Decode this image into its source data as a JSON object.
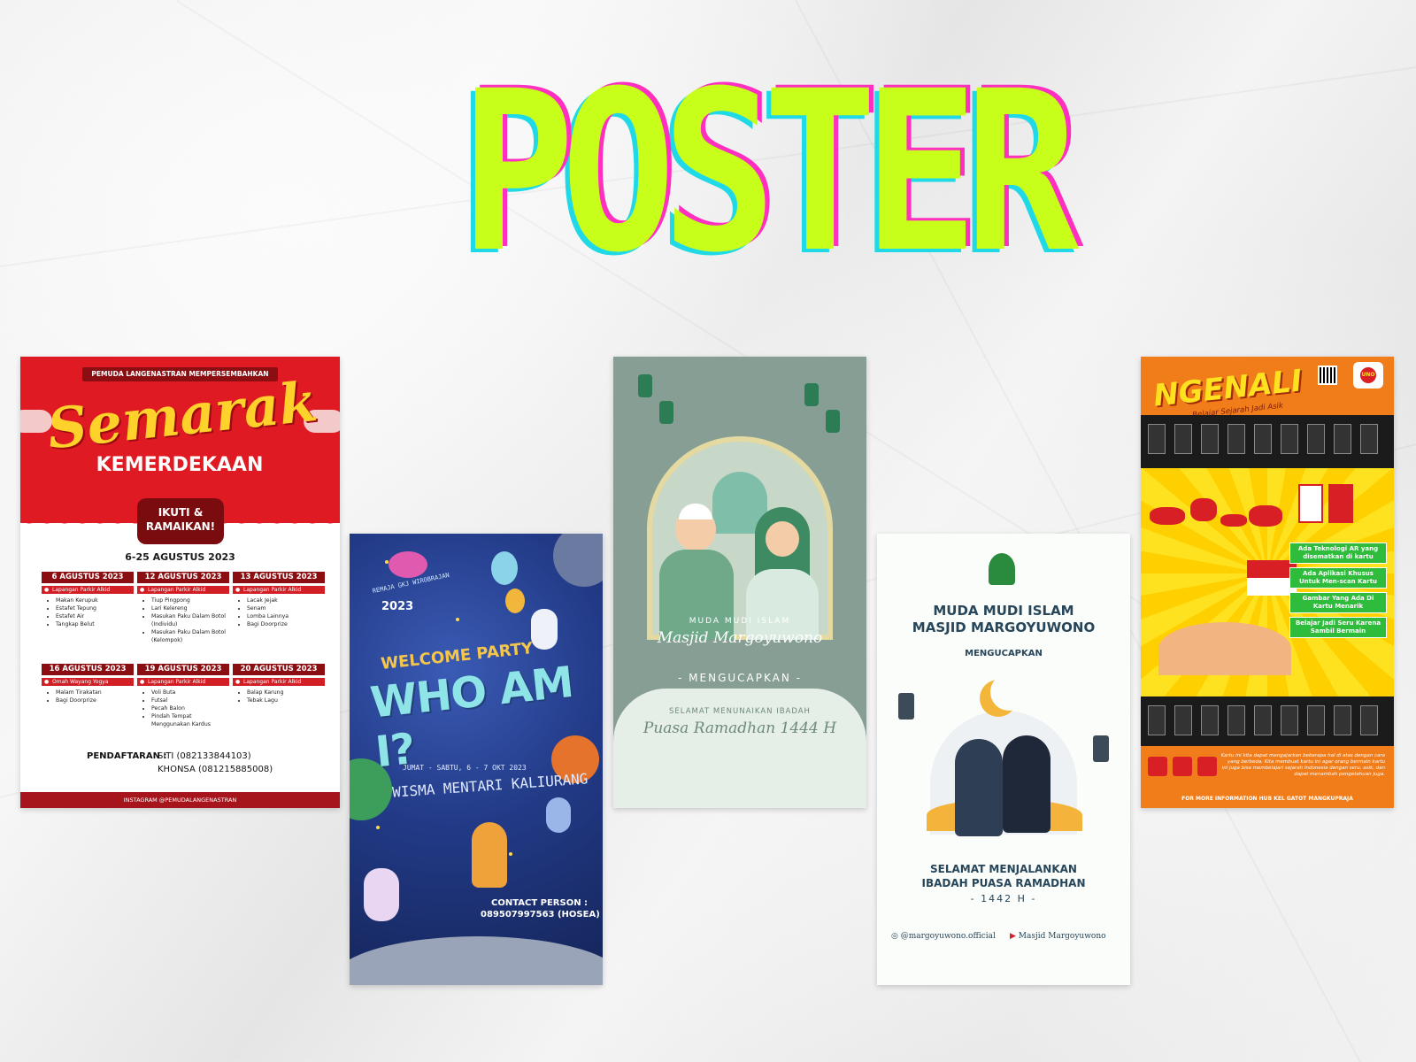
{
  "title": "POSTER",
  "colors": {
    "title_main": "#c8ff1a",
    "title_cyan": "#1fd9e6",
    "title_pink": "#ff2fc0"
  },
  "poster1": {
    "pill": "PEMUDA LANGENASTRAN MEMPERSEMBAHKAN",
    "semarak": "Semarak",
    "kemerdekaan": "KEMERDEKAAN",
    "ikuti": "IKUTI &",
    "ramaikan": "RAMAIKAN!",
    "dates": "6-25 AGUSTUS 2023",
    "events": [
      {
        "date": "6 AGUSTUS 2023",
        "location": "Lapangan Parkir Alkid",
        "items": [
          "Makan Kerupuk",
          "Estafet Tepung",
          "Estafet Air",
          "Tangkap Belut"
        ]
      },
      {
        "date": "12 AGUSTUS 2023",
        "location": "Lapangan Parkir Alkid",
        "items": [
          "Tiup Pingpong",
          "Lari Kelereng",
          "Masukan Paku Dalam Botol (Individu)",
          "Masukan Paku Dalam Botol (Kelompok)"
        ]
      },
      {
        "date": "13 AGUSTUS 2023",
        "location": "Lapangan Parkir Alkid",
        "items": [
          "Lacak Jejak",
          "Senam",
          "Lomba Lainnya",
          "Bagi Doorprize"
        ]
      },
      {
        "date": "16 AGUSTUS 2023",
        "location": "Omah Wayang Yogya",
        "items": [
          "Malam Tirakatan",
          "Bagi Doorprize"
        ]
      },
      {
        "date": "19 AGUSTUS 2023",
        "location": "Lapangan Parkir Alkid",
        "items": [
          "Voli Buta",
          "Futsal",
          "Pecah Balon",
          "Pindah Tempat Menggunakan Kardus"
        ]
      },
      {
        "date": "20 AGUSTUS 2023",
        "location": "Lapangan Parkir Alkid",
        "items": [
          "Balap Karung",
          "Tebak Lagu"
        ]
      }
    ],
    "registration_label": "PENDAFTARAN :",
    "registration_1": "SITI (082133844103)",
    "registration_2": "KHONSA (081215885008)",
    "footer": "INSTAGRAM @PEMUDALANGENASTRAN"
  },
  "poster2": {
    "sub": "REMAJA GKJ WIROBRAJAN",
    "year": "2023",
    "welcome": "WELCOME PARTY",
    "who": "WHO AM I?",
    "date": "JUMAT - SABTU, 6 - 7 OKT 2023",
    "venue": "WISMA MENTARI KALIURANG",
    "contact_label": "CONTACT PERSON :",
    "contact_value": "089507997563 (HOSEA)"
  },
  "poster3": {
    "mudi": "MUDA MUDI ISLAM",
    "masjid": "Masjid Margoyuwono",
    "mengucapkan": "- MENGUCAPKAN -",
    "selamat": "SELAMAT MENUNAIKAN IBADAH",
    "puasa": "Puasa Ramadhan 1444 H"
  },
  "poster4": {
    "line1": "MUDA MUDI ISLAM",
    "line2": "MASJID MARGOYUWONO",
    "mengucapkan": "MENGUCAPKAN",
    "sel1": "SELAMAT MENJALANKAN",
    "sel2": "IBADAH PUASA RAMADHAN",
    "hijri": "- 1442 H -",
    "instagram": "@margoyuwono.official",
    "youtube": "Masjid Margoyuwono"
  },
  "poster5": {
    "title": "NGENALI",
    "tagline": "Belajar Sejarah Jadi Asik",
    "logo": "UNO",
    "features": [
      "Ada Teknologi AR yang disematkan di kartu",
      "Ada Aplikasi Khusus Untuk Men-scan Kartu",
      "Gambar Yang Ada Di Kartu Menarik",
      "Belajar Jadi Seru Karena Sambil Bermain"
    ],
    "description": "Kartu ini kita dapat mengajarkan beberapa hal di atas dengan cara yang berbeda. Kita membuat kartu ini agar orang bermain kartu ini juga bisa membelajari sejarah Indonesia dengan seru, asik, dan dapat menambah pengetahuan juga.",
    "footer": "FOR MORE INFORMATION HUB KEL GATOT MANGKUPRAJA"
  }
}
